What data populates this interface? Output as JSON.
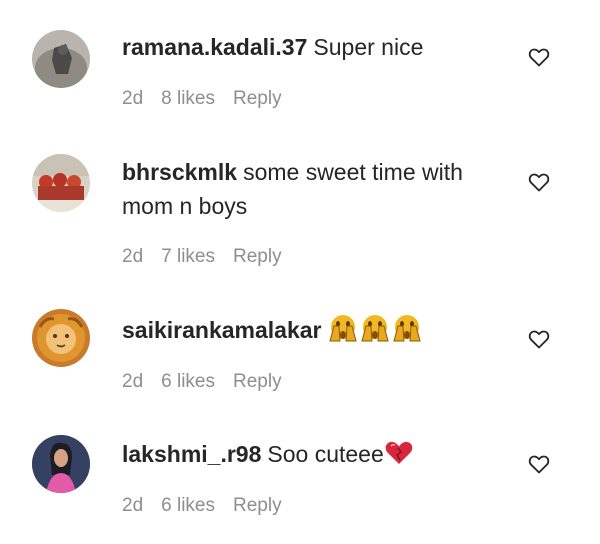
{
  "comments": [
    {
      "username": "ramana.kadali.37",
      "text": "Super nice",
      "time": "2d",
      "likes": "8 likes",
      "reply": "Reply",
      "avatar_icon": "avatar-ramana",
      "like_icon": "heart-outline-icon"
    },
    {
      "username": "bhrsckmlk",
      "text": "some sweet time with mom n boys",
      "time": "2d",
      "likes": "7 likes",
      "reply": "Reply",
      "avatar_icon": "avatar-bhrsckmlk",
      "like_icon": "heart-outline-icon"
    },
    {
      "username": "saikirankamalakar",
      "text": "",
      "emojis": [
        "hands-over-mouth-emoji",
        "hands-over-mouth-emoji",
        "hands-over-mouth-emoji"
      ],
      "time": "2d",
      "likes": "6 likes",
      "reply": "Reply",
      "avatar_icon": "avatar-saikiran",
      "like_icon": "heart-outline-icon"
    },
    {
      "username": "lakshmi_.r98",
      "text": "Soo cuteee",
      "emojis": [
        "red-heart-emoji"
      ],
      "time": "2d",
      "likes": "6 likes",
      "reply": "Reply",
      "avatar_icon": "avatar-lakshmi",
      "like_icon": "heart-outline-icon"
    }
  ],
  "colors": {
    "text": "#262626",
    "meta": "#8e8e8e",
    "heart_outline": "#262626",
    "heart_emoji": "#d7263d",
    "emoji_yellow": "#f2b824"
  }
}
